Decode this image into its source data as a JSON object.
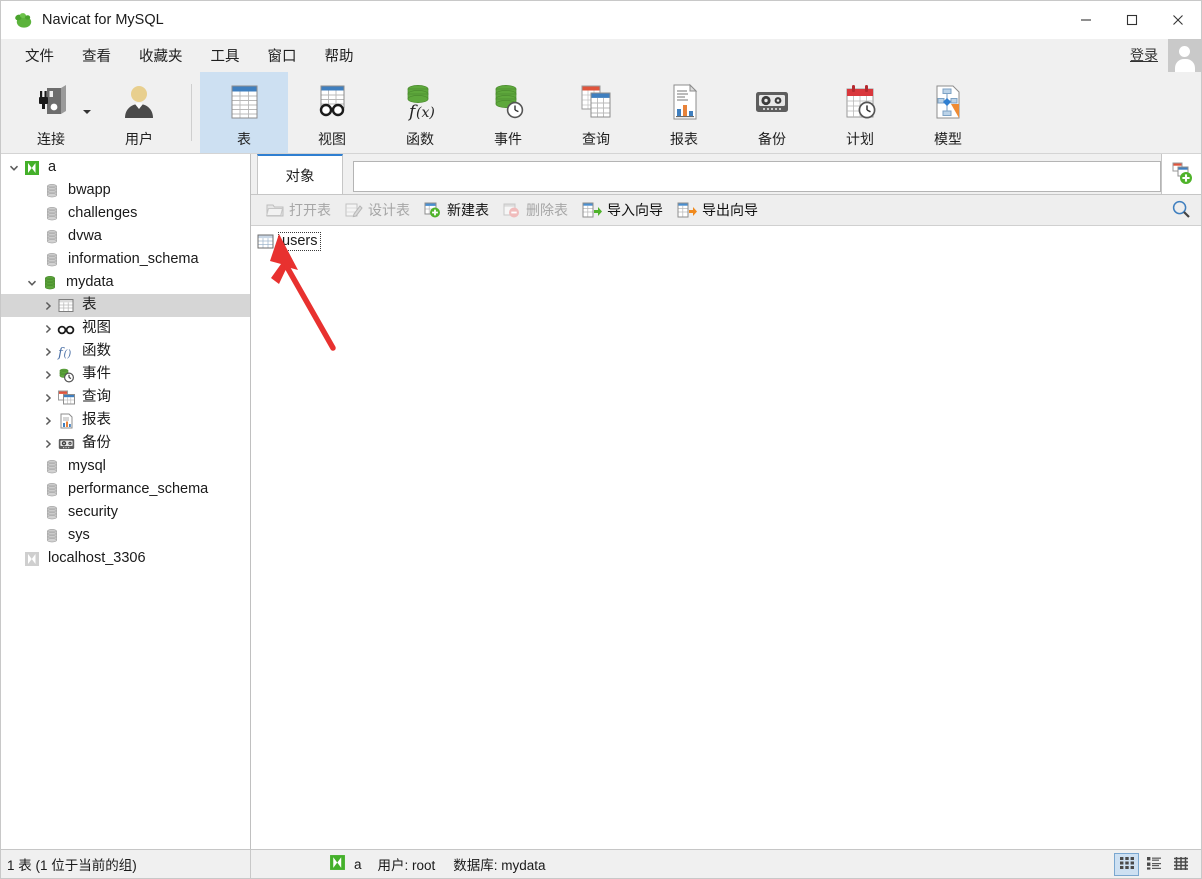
{
  "window": {
    "title": "Navicat for MySQL",
    "logo_icon": "navicat-logo-icon",
    "minimize_icon": "minimize-icon",
    "maximize_icon": "maximize-icon",
    "close_icon": "close-icon"
  },
  "menubar": {
    "items": [
      {
        "label": "文件"
      },
      {
        "label": "查看"
      },
      {
        "label": "收藏夹"
      },
      {
        "label": "工具"
      },
      {
        "label": "窗口"
      },
      {
        "label": "帮助"
      }
    ],
    "login_label": "登录",
    "avatar_icon": "user-avatar-icon"
  },
  "toolbar": {
    "items": [
      {
        "label": "连接",
        "icon": "connection-plug-icon",
        "has_dropdown": true,
        "selected": false
      },
      {
        "label": "用户",
        "icon": "user-icon",
        "selected": false
      },
      {
        "label": "表",
        "icon": "table-icon",
        "selected": true
      },
      {
        "label": "视图",
        "icon": "view-glasses-icon",
        "selected": false
      },
      {
        "label": "函数",
        "icon": "function-fx-icon",
        "selected": false
      },
      {
        "label": "事件",
        "icon": "event-clock-icon",
        "selected": false
      },
      {
        "label": "查询",
        "icon": "query-icon",
        "selected": false
      },
      {
        "label": "报表",
        "icon": "report-icon",
        "selected": false
      },
      {
        "label": "备份",
        "icon": "backup-tape-icon",
        "selected": false
      },
      {
        "label": "计划",
        "icon": "schedule-calendar-icon",
        "selected": false
      },
      {
        "label": "模型",
        "icon": "model-diagram-icon",
        "selected": false
      }
    ]
  },
  "sidebar": {
    "nodes": [
      {
        "label": "a",
        "icon": "connection-icon-green",
        "indent": 0,
        "expander": "down",
        "selected": false
      },
      {
        "label": "bwapp",
        "icon": "database-gray-icon",
        "indent": 1,
        "expander": "none",
        "selected": false
      },
      {
        "label": "challenges",
        "icon": "database-gray-icon",
        "indent": 1,
        "expander": "none",
        "selected": false
      },
      {
        "label": "dvwa",
        "icon": "database-gray-icon",
        "indent": 1,
        "expander": "none",
        "selected": false
      },
      {
        "label": "information_schema",
        "icon": "database-gray-icon",
        "indent": 1,
        "expander": "none",
        "selected": false
      },
      {
        "label": "mydata",
        "icon": "database-green-icon",
        "indent": 1,
        "expander": "down",
        "selected": false
      },
      {
        "label": "表",
        "icon": "table-icon",
        "indent": 2,
        "expander": "right",
        "selected": true
      },
      {
        "label": "视图",
        "icon": "view-glasses-icon",
        "indent": 2,
        "expander": "right",
        "selected": false
      },
      {
        "label": "函数",
        "icon": "function-fx-icon",
        "indent": 2,
        "expander": "right",
        "selected": false
      },
      {
        "label": "事件",
        "icon": "event-clock-icon",
        "indent": 2,
        "expander": "right",
        "selected": false
      },
      {
        "label": "查询",
        "icon": "query-icon",
        "indent": 2,
        "expander": "right",
        "selected": false
      },
      {
        "label": "报表",
        "icon": "report-icon",
        "indent": 2,
        "expander": "right",
        "selected": false
      },
      {
        "label": "备份",
        "icon": "backup-tape-icon",
        "indent": 2,
        "expander": "right",
        "selected": false
      },
      {
        "label": "mysql",
        "icon": "database-gray-icon",
        "indent": 1,
        "expander": "none",
        "selected": false
      },
      {
        "label": "performance_schema",
        "icon": "database-gray-icon",
        "indent": 1,
        "expander": "none",
        "selected": false
      },
      {
        "label": "security",
        "icon": "database-gray-icon",
        "indent": 1,
        "expander": "none",
        "selected": false
      },
      {
        "label": "sys",
        "icon": "database-gray-icon",
        "indent": 1,
        "expander": "none",
        "selected": false
      },
      {
        "label": "localhost_3306",
        "icon": "connection-icon-gray",
        "indent": 0,
        "expander": "none",
        "selected": false
      }
    ]
  },
  "main": {
    "tab_label": "对象",
    "search_value": "",
    "search_placeholder": "",
    "new_object_icon": "new-object-plus-icon",
    "actions": [
      {
        "label": "打开表",
        "icon": "open-table-icon",
        "enabled": false
      },
      {
        "label": "设计表",
        "icon": "design-table-icon",
        "enabled": false
      },
      {
        "label": "新建表",
        "icon": "new-table-plus-icon",
        "enabled": true
      },
      {
        "label": "删除表",
        "icon": "delete-table-minus-icon",
        "enabled": false
      },
      {
        "label": "导入向导",
        "icon": "import-wizard-icon",
        "enabled": true
      },
      {
        "label": "导出向导",
        "icon": "export-wizard-icon",
        "enabled": true
      }
    ],
    "search_icon": "magnifier-icon",
    "objects": [
      {
        "label": "users",
        "icon": "table-icon",
        "focused": true
      }
    ],
    "annotation": {
      "type": "arrow",
      "color": "#e8312f"
    }
  },
  "statusbar": {
    "left_text": "1 表 (1 位于当前的组)",
    "connection_icon": "connection-icon-green",
    "connection_name": "a",
    "user_text": "用户: root",
    "database_text": "数据库: mydata",
    "view_modes": [
      {
        "name": "grid-view",
        "icon": "grid-view-icon",
        "active": true
      },
      {
        "name": "list-view",
        "icon": "list-view-icon",
        "active": false
      },
      {
        "name": "detail-view",
        "icon": "detail-view-icon",
        "active": false
      }
    ]
  },
  "colors": {
    "accent_blue": "#2f7fd1",
    "selection_blue": "#cde0f2",
    "toolbar_bg": "#f0f0f0",
    "annotation_red": "#e8312f",
    "green_db": "#5ba33a"
  }
}
